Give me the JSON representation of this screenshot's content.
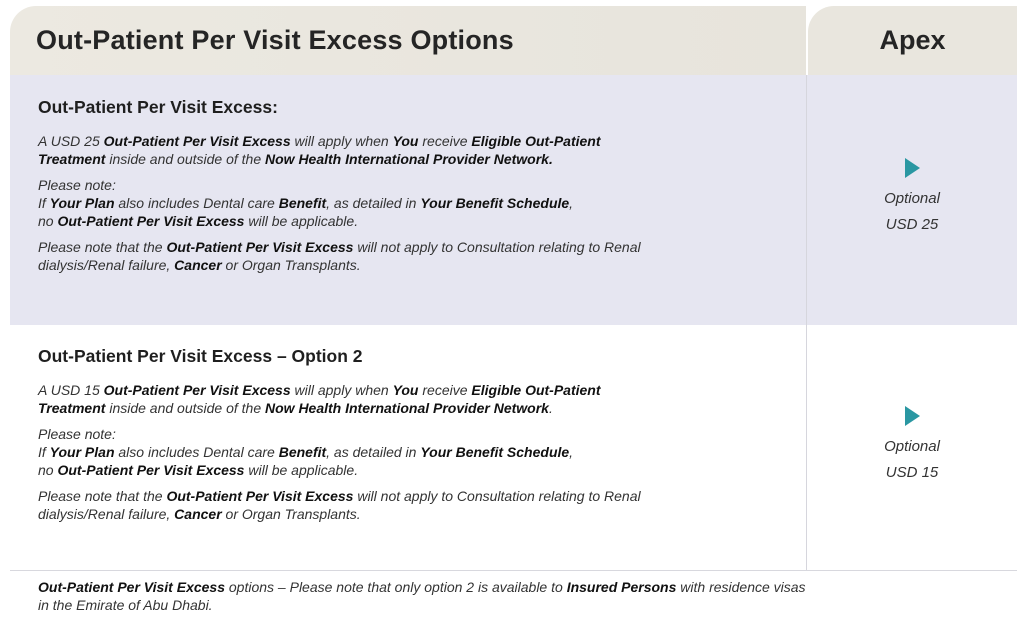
{
  "header": {
    "title": "Out-Patient Per Visit Excess Options",
    "plan": "Apex"
  },
  "rows": [
    {
      "title": "Out-Patient Per Visit Excess:",
      "p1": [
        "A USD 25 ",
        "Out-Patient Per Visit Excess",
        " will apply when ",
        "You",
        " receive ",
        "Eligible Out-Patient",
        "Treatment",
        " inside and outside of the ",
        "Now Health International Provider Network."
      ],
      "note_label": "Please note:",
      "note": [
        "If ",
        "Your Plan",
        " also includes Dental care ",
        "Benefit",
        ", as detailed in ",
        "Your Benefit Schedule",
        ",",
        "no ",
        "Out-Patient Per Visit Excess",
        " will be applicable."
      ],
      "p3": [
        "Please note that the ",
        "Out-Patient Per Visit Excess",
        " will not apply to Consultation relating to Renal",
        "dialysis/Renal failure, ",
        "Cancer",
        " or Organ Transplants."
      ],
      "status": "Optional",
      "amount": "USD 25"
    },
    {
      "title": "Out-Patient Per Visit Excess – Option 2",
      "p1": [
        "A USD 15 ",
        "Out-Patient Per Visit Excess",
        " will apply when ",
        "You",
        " receive ",
        "Eligible Out-Patient",
        "Treatment",
        " inside and outside of the ",
        "Now Health International Provider Network",
        "."
      ],
      "note_label": "Please note:",
      "note": [
        "If ",
        "Your Plan",
        " also includes Dental care ",
        "Benefit",
        ", as detailed in ",
        "Your Benefit Schedule",
        ",",
        "no ",
        "Out-Patient Per Visit Excess",
        " will be applicable."
      ],
      "p3": [
        "Please note that the ",
        "Out-Patient Per Visit Excess",
        " will not apply to Consultation relating to Renal",
        "dialysis/Renal failure, ",
        "Cancer",
        " or Organ Transplants."
      ],
      "status": "Optional",
      "amount": "USD 15"
    }
  ],
  "footnote": [
    "Out-Patient Per Visit Excess",
    " options – Please note that only option 2 is available to ",
    "Insured Persons",
    " with residence visas",
    "in the Emirate of Abu Dhabi."
  ],
  "colors": {
    "header_bg": "#e9e6de",
    "row1_bg": "#e6e6f1",
    "marker": "#2a97a2"
  }
}
